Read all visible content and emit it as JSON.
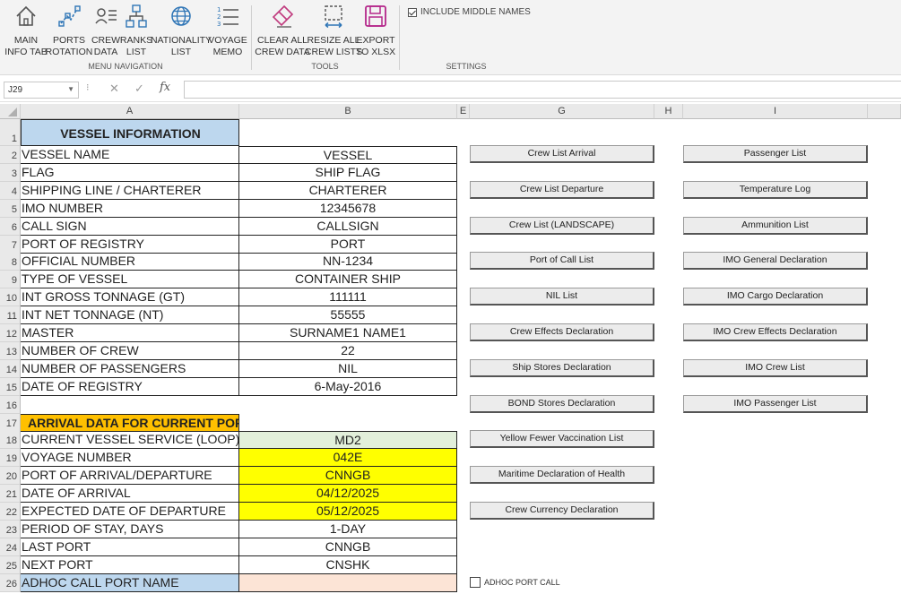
{
  "ribbon": {
    "buttons": [
      {
        "label": "MAIN\nINFO TAB",
        "icon": "home-icon"
      },
      {
        "label": "PORTS\nROTATION",
        "icon": "route-icon"
      },
      {
        "label": "CREW\nDATA",
        "icon": "crew-list-icon"
      },
      {
        "label": "RANKS\nLIST",
        "icon": "hierarchy-icon"
      },
      {
        "label": "NATIONALITY\nLIST",
        "icon": "globe-icon"
      },
      {
        "label": "VOYAGE\nMEMO",
        "icon": "numbered-list-icon"
      },
      {
        "label": "CLEAR ALL\nCREW DATA",
        "icon": "eraser-icon"
      },
      {
        "label": "RESIZE ALL\nCREW LISTS",
        "icon": "resize-icon"
      },
      {
        "label": "EXPORT\nTO XLSX",
        "icon": "save-icon"
      }
    ],
    "groups": {
      "nav": "MENU NAVIGATION",
      "tools": "TOOLS",
      "settings": "SETTINGS"
    },
    "include_middle_names": {
      "label": "INCLUDE MIDDLE NAMES",
      "checked": true
    }
  },
  "formula_bar": {
    "name_box": "J29",
    "cancel": "✕",
    "enter": "✓",
    "fx": "fx",
    "formula": ""
  },
  "columns": [
    "A",
    "B",
    "E",
    "G",
    "H",
    "I"
  ],
  "rows": [
    "1",
    "2",
    "3",
    "4",
    "5",
    "6",
    "7",
    "8",
    "9",
    "10",
    "11",
    "12",
    "13",
    "14",
    "15",
    "16",
    "17",
    "18",
    "19",
    "20",
    "21",
    "22",
    "23",
    "24",
    "25",
    "26"
  ],
  "vessel": {
    "header": "VESSEL INFORMATION",
    "fields": [
      {
        "label": "VESSEL NAME",
        "value": "VESSEL"
      },
      {
        "label": "FLAG",
        "value": "SHIP FLAG"
      },
      {
        "label": "SHIPPING LINE / CHARTERER",
        "value": "CHARTERER"
      },
      {
        "label": "IMO NUMBER",
        "value": "12345678"
      },
      {
        "label": "CALL SIGN",
        "value": "CALLSIGN"
      },
      {
        "label": "PORT OF REGISTRY",
        "value": "PORT"
      },
      {
        "label": "OFFICIAL NUMBER",
        "value": "NN-1234"
      },
      {
        "label": "TYPE OF VESSEL",
        "value": "CONTAINER SHIP"
      },
      {
        "label": "INT GROSS TONNAGE (GT)",
        "value": "111111"
      },
      {
        "label": "INT NET TONNAGE (NT)",
        "value": "55555"
      },
      {
        "label": "MASTER",
        "value": "SURNAME1 NAME1"
      },
      {
        "label": "NUMBER OF CREW",
        "value": "22"
      },
      {
        "label": "NUMBER OF PASSENGERS",
        "value": "NIL"
      },
      {
        "label": "DATE OF REGISTRY",
        "value": "6-May-2016"
      }
    ]
  },
  "arrival": {
    "header": "ARRIVAL DATA FOR CURRENT PORT",
    "fields": [
      {
        "label": "CURRENT VESSEL SERVICE (LOOP)",
        "value": "MD2",
        "fill": "grn"
      },
      {
        "label": "VOYAGE NUMBER",
        "value": "042E",
        "fill": "yel"
      },
      {
        "label": "PORT OF ARRIVAL/DEPARTURE",
        "value": "CNNGB",
        "fill": "yel"
      },
      {
        "label": "DATE OF ARRIVAL",
        "value": "04/12/2025",
        "fill": "yel"
      },
      {
        "label": "EXPECTED DATE OF DEPARTURE",
        "value": "05/12/2025",
        "fill": "yel"
      },
      {
        "label": "PERIOD OF STAY, DAYS",
        "value": "1-DAY",
        "fill": ""
      },
      {
        "label": "LAST PORT",
        "value": "CNNGB",
        "fill": ""
      },
      {
        "label": "NEXT PORT",
        "value": "CNSHK",
        "fill": ""
      },
      {
        "label": "ADHOC CALL PORT NAME",
        "value": "",
        "fill": "pch"
      }
    ]
  },
  "buttons_g": [
    "Crew List Arrival",
    "Crew List Departure",
    "Crew List (LANDSCAPE)",
    "Port of Call List",
    "NIL List",
    "Crew Effects Declaration",
    "Ship Stores Declaration",
    "BOND Stores Declaration",
    "Yellow Fewer Vaccination List",
    "Maritime Declaration of Health",
    "Crew Currency Declaration"
  ],
  "buttons_i": [
    "Passenger List",
    "Temperature Log",
    "Ammunition List",
    "IMO General Declaration",
    "IMO Cargo Declaration",
    "IMO Crew Effects Declaration",
    "IMO Crew List",
    "IMO Passenger List"
  ],
  "adhoc_checkbox": {
    "label": "ADHOC PORT CALL",
    "checked": false
  }
}
